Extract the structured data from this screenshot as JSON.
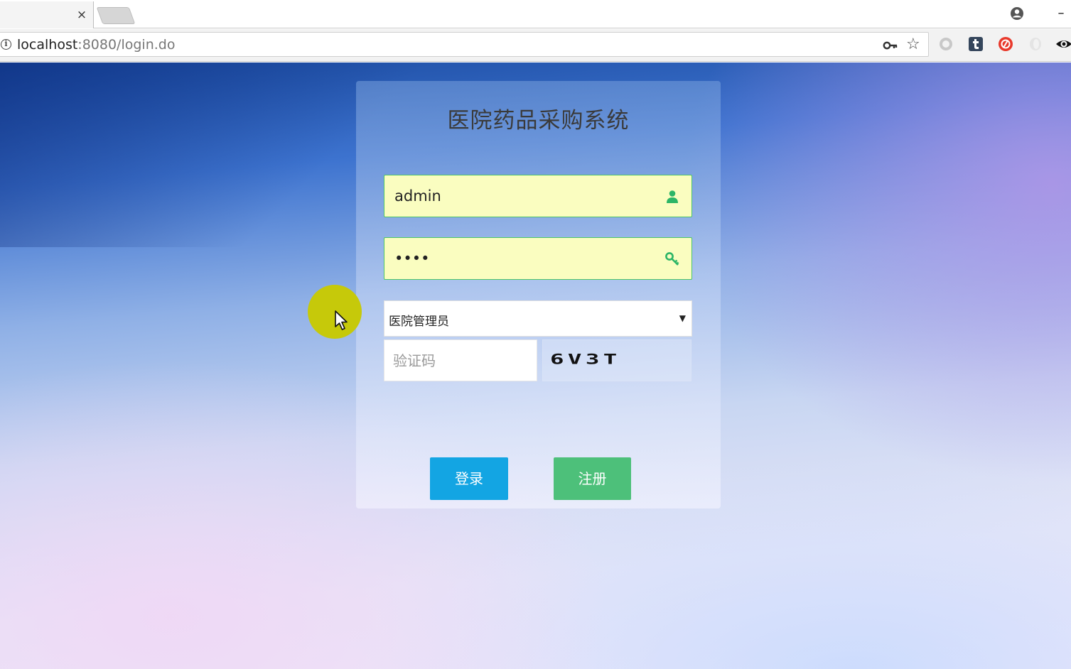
{
  "browser": {
    "tab_close": "×",
    "minimize": "–",
    "url_host": "localhost",
    "url_rest": ":8080/login.do"
  },
  "login": {
    "title": "医院药品采购系统",
    "username_value": "admin",
    "password_value": "1234",
    "role_selected": "医院管理员",
    "captcha_placeholder": "验证码",
    "captcha_image_text": "6V3T",
    "login_button": "登录",
    "register_button": "注册"
  },
  "colors": {
    "login_button": "#13a5e3",
    "register_button": "#4dc07a",
    "field_highlight": "#fafdc0",
    "field_border": "#4cc46a",
    "cursor_highlight": "#c6c90a"
  },
  "icons": [
    "user-icon",
    "key-icon",
    "profile-icon",
    "info-icon",
    "star-icon",
    "password-key-icon",
    "dropdown-caret-icon"
  ]
}
